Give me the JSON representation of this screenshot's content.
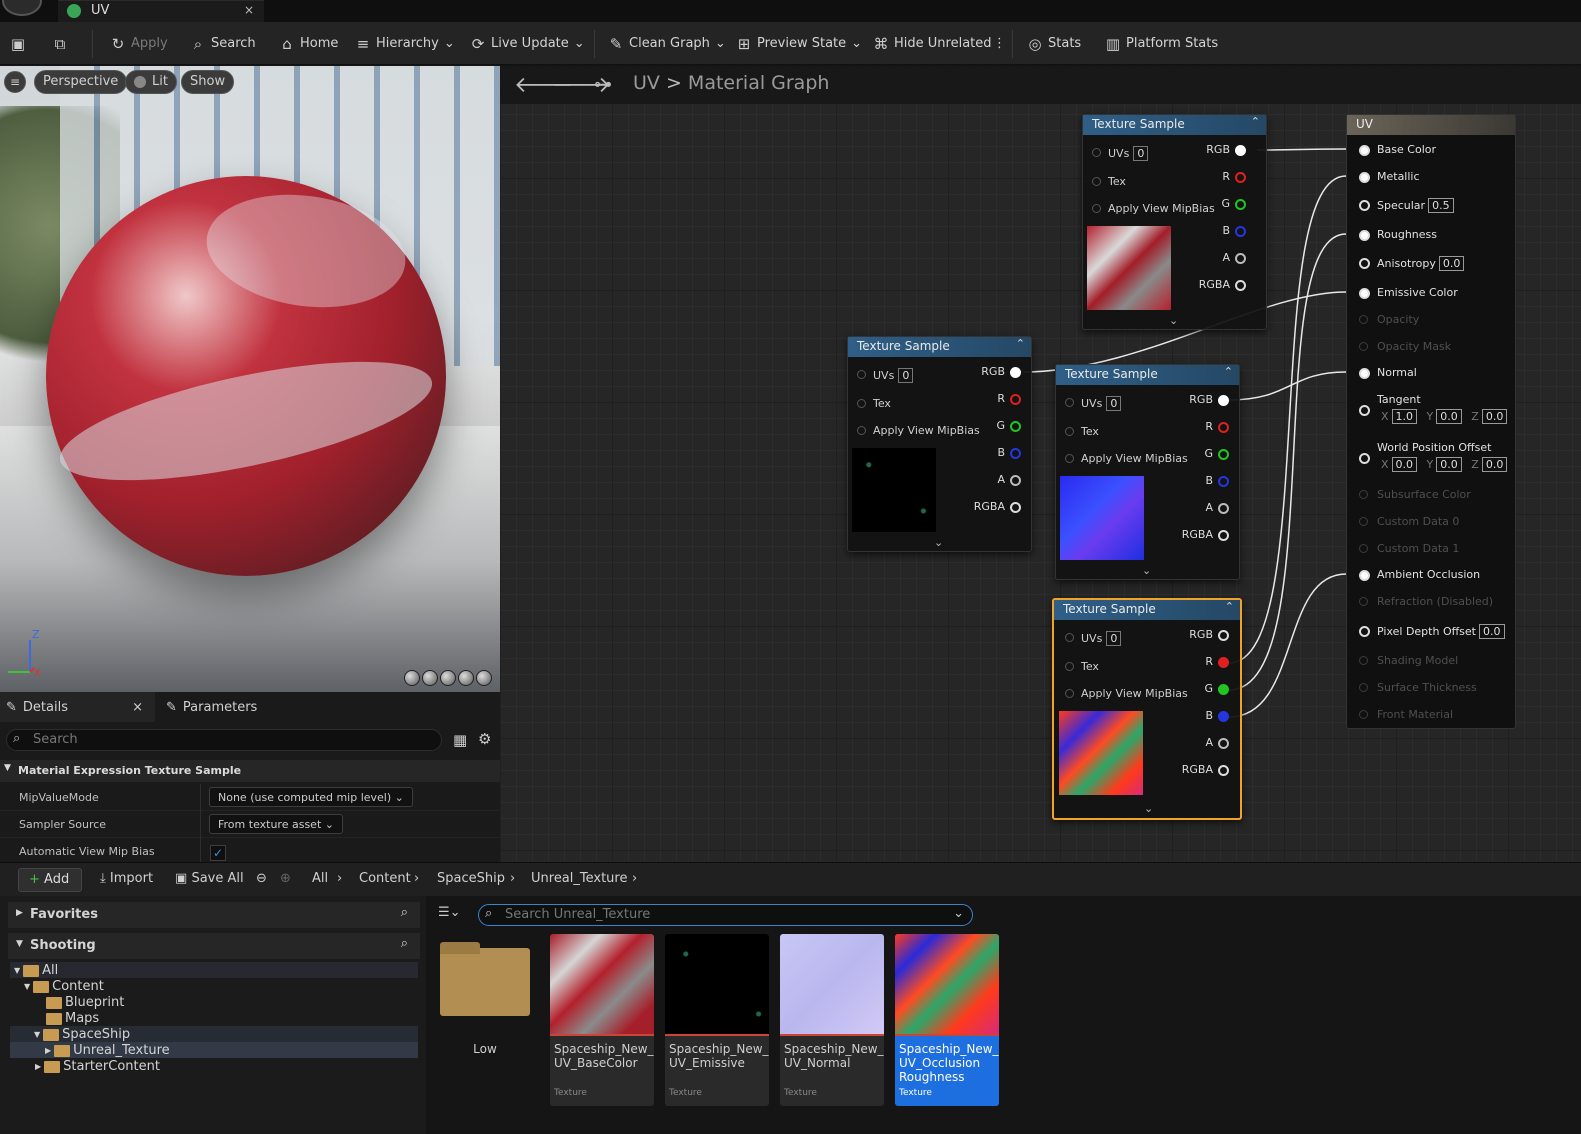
{
  "tab": {
    "title": "UV",
    "close": "×"
  },
  "toolbar": {
    "apply": "Apply",
    "search": "Search",
    "home": "Home",
    "hierarchy": "Hierarchy",
    "live_update": "Live Update",
    "clean_graph": "Clean Graph",
    "preview_state": "Preview State",
    "hide_unrelated": "Hide Unrelated",
    "stats": "Stats",
    "platform_stats": "Platform Stats"
  },
  "viewport": {
    "perspective": "Perspective",
    "lit": "Lit",
    "show": "Show",
    "axis_z": "Z",
    "axis_x": "X"
  },
  "details": {
    "tab_details": "Details",
    "tab_parameters": "Parameters",
    "close": "×",
    "search_placeholder": "Search",
    "section": "Material Expression Texture Sample",
    "rows": [
      {
        "label": "MipValueMode",
        "value": "None (use computed mip level)"
      },
      {
        "label": "Sampler Source",
        "value": "From texture asset"
      },
      {
        "label": "Automatic View Mip Bias",
        "value": "✓"
      }
    ]
  },
  "graph": {
    "crumb_root": "UV",
    "crumb_sep": ">",
    "crumb_leaf": "Material Graph",
    "node_title": "Texture Sample",
    "inputs": {
      "uvs": "UVs",
      "uvs_val": "0",
      "tex": "Tex",
      "mip": "Apply View MipBias"
    },
    "outputs": [
      "RGB",
      "R",
      "G",
      "B",
      "A",
      "RGBA"
    ],
    "result": {
      "title": "UV",
      "pins": [
        {
          "label": "Base Color",
          "enabled": true
        },
        {
          "label": "Metallic",
          "enabled": true
        },
        {
          "label": "Specular",
          "enabled": true,
          "value": "0.5"
        },
        {
          "label": "Roughness",
          "enabled": true
        },
        {
          "label": "Anisotropy",
          "enabled": true,
          "value": "0.0"
        },
        {
          "label": "Emissive Color",
          "enabled": true
        },
        {
          "label": "Opacity",
          "enabled": false
        },
        {
          "label": "Opacity Mask",
          "enabled": false
        },
        {
          "label": "Normal",
          "enabled": true
        },
        {
          "label": "Tangent",
          "enabled": true
        },
        {
          "label": "World Position Offset",
          "enabled": true
        },
        {
          "label": "Subsurface Color",
          "enabled": false
        },
        {
          "label": "Custom Data 0",
          "enabled": false
        },
        {
          "label": "Custom Data 1",
          "enabled": false
        },
        {
          "label": "Ambient Occlusion",
          "enabled": true
        },
        {
          "label": "Refraction (Disabled)",
          "enabled": false
        },
        {
          "label": "Pixel Depth Offset",
          "enabled": true,
          "value": "0.0"
        },
        {
          "label": "Shading Model",
          "enabled": false
        },
        {
          "label": "Surface Thickness",
          "enabled": false
        },
        {
          "label": "Front Material",
          "enabled": false
        }
      ],
      "tangent": {
        "x": "1.0",
        "y": "0.0",
        "z": "0.0"
      },
      "wpo": {
        "x": "0.0",
        "y": "0.0",
        "z": "0.0"
      },
      "axis_labels": {
        "x": "X",
        "y": "Y",
        "z": "Z"
      }
    }
  },
  "content_browser": {
    "add": "Add",
    "import": "Import",
    "save_all": "Save All",
    "path": [
      "All",
      "Content",
      "SpaceShip",
      "Unreal_Texture"
    ],
    "favorites": "Favorites",
    "collection": "Shooting",
    "tree": [
      "All",
      "Content",
      "Blueprint",
      "Maps",
      "SpaceShip",
      "Unreal_Texture",
      "StarterContent"
    ],
    "search_placeholder": "Search Unreal_Texture",
    "assets": [
      {
        "name": "Low",
        "type": ""
      },
      {
        "name": "Spaceship_New_ UV_BaseColor",
        "type": "Texture"
      },
      {
        "name": "Spaceship_New_ UV_Emissive",
        "type": "Texture"
      },
      {
        "name": "Spaceship_New_ UV_Normal",
        "type": "Texture"
      },
      {
        "name": "Spaceship_New_ UV_Occlusion Roughness",
        "type": "Texture"
      }
    ]
  },
  "colors": {
    "accent": "#f3a428",
    "selection": "#1d6fe0",
    "node_header": "#2f5f88",
    "pin_r": "#e02020",
    "pin_g": "#22c422",
    "pin_b": "#2436e0"
  }
}
